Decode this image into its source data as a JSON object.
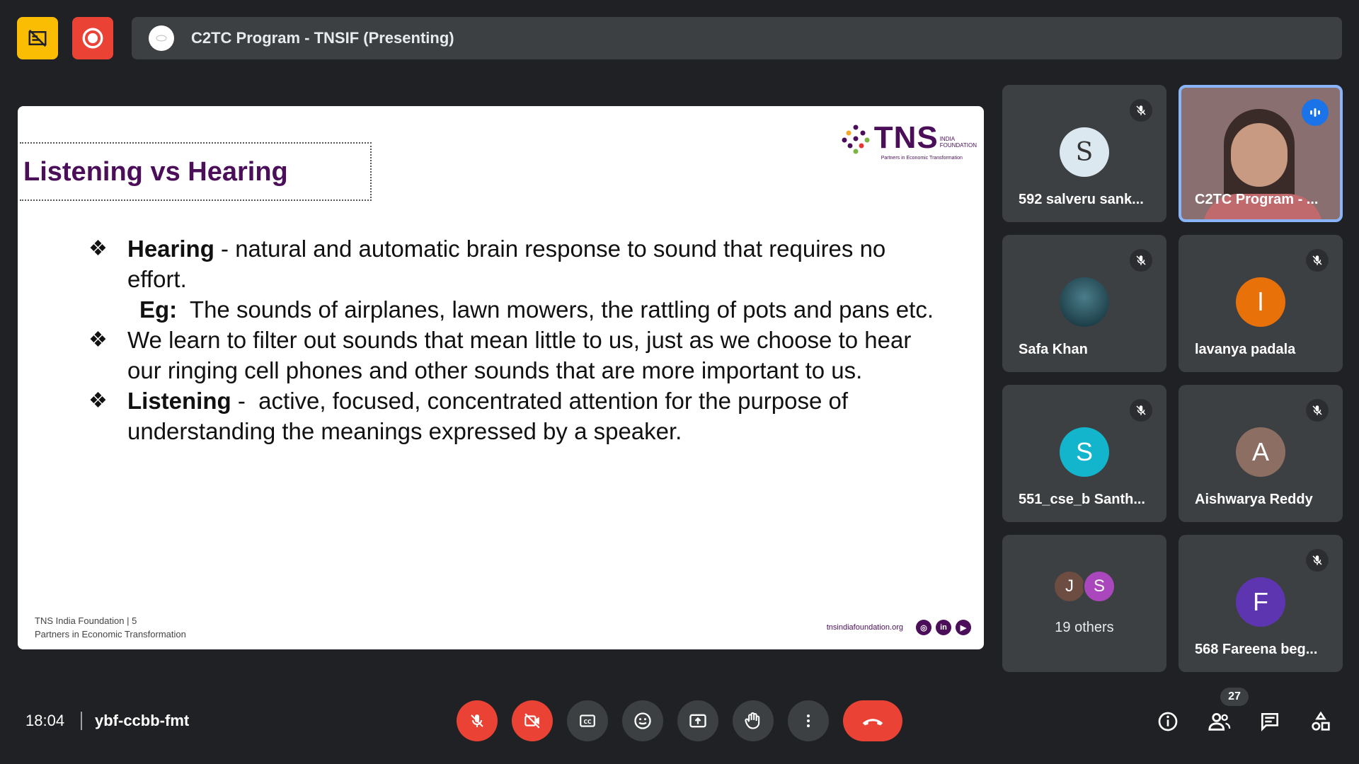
{
  "top": {
    "presentation_title": "C2TC Program - TNSIF (Presenting)"
  },
  "slide": {
    "title": "Listening vs Hearing",
    "logo": {
      "name": "TNS",
      "sub1": "INDIA",
      "sub2": "FOUNDATION",
      "tagline": "Partners in Economic Transformation"
    },
    "bullets": [
      {
        "mark": "❖",
        "bold": "Hearing",
        "text": " - natural and automatic brain response to sound that requires no effort.",
        "eg_bold": "Eg:",
        "eg_text": "  The sounds of airplanes, lawn mowers, the rattling of pots and pans etc."
      },
      {
        "mark": "❖",
        "text": "We learn to filter out sounds that mean little to us, just as we choose to hear our ringing cell phones and other sounds that are more important to us."
      },
      {
        "mark": "❖",
        "bold": "Listening",
        "text": " -  active, focused, concentrated attention for the purpose of understanding the meanings expressed by a speaker."
      }
    ],
    "footer_line1": "TNS India Foundation | 5",
    "footer_line2": "Partners in Economic Transformation",
    "footer_url": "tnsindiafoundation.org"
  },
  "participants": [
    {
      "name": "592 salveru sank...",
      "avatar": "S"
    },
    {
      "name": "C2TC Program - ..."
    },
    {
      "name": "Safa Khan"
    },
    {
      "name": "lavanya padala",
      "initial": "l",
      "color": "#e8710a"
    },
    {
      "name": "551_cse_b Santh...",
      "initial": "S",
      "color": "#12b5cb"
    },
    {
      "name": "Aishwarya Reddy",
      "initial": "A",
      "color": "#8d6e63"
    },
    {
      "others_label": "19 others",
      "mini1": "J",
      "mini2": "S"
    },
    {
      "name": "568 Fareena beg...",
      "initial": "F",
      "color": "#5e35b1"
    }
  ],
  "bottom": {
    "time": "18:04",
    "meeting_code": "ybf-ccbb-fmt",
    "people_count": "27"
  },
  "colors": {
    "accent": "#ea4335",
    "brand": "#4b0f5a",
    "active_border": "#8ab4f8"
  }
}
